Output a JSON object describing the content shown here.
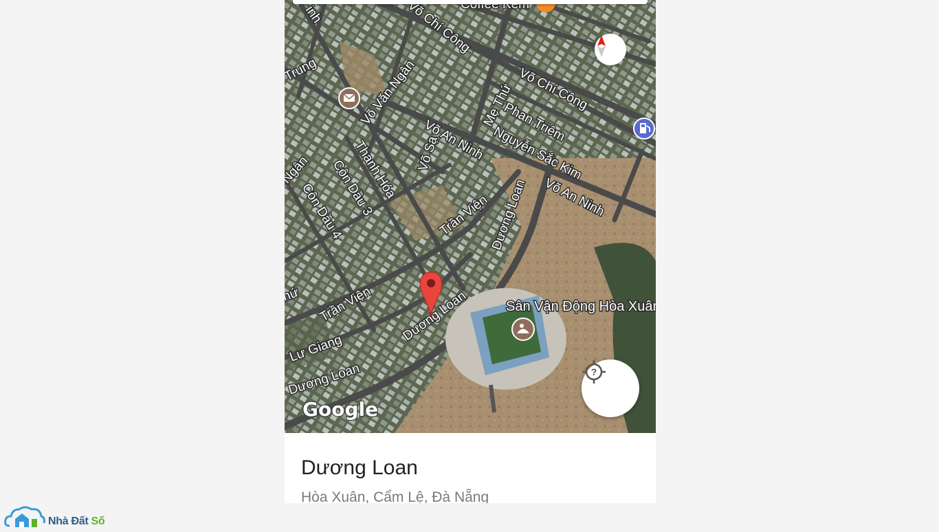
{
  "map": {
    "roads": [
      "Võ Chí Công",
      "Võ Chí Công",
      "Phan Triêm",
      "Mẹ Thứ",
      "Võ An Ninh",
      "Nguyễn Sắc Kim",
      "Võ An Ninh",
      "Võ Văn Ngân",
      "Võ Sạ",
      "Thanh Hóa",
      "Côn Dầu 3",
      "Côn Dầu 4",
      "Trần Viện",
      "Dương Loan",
      "Trần Viện",
      "Dương Loan",
      "Lư Giang",
      "Dương Loan",
      "Trung",
      "Ngân",
      "hứ",
      "inh"
    ],
    "poi_top": "Coffee Kem",
    "stadium_label": "Sân Vận Động Hòa Xuân",
    "provider_logo": "Google",
    "icons": {
      "compass": "compass-icon",
      "locate": "locate-question-icon",
      "pin": "map-pin-icon",
      "post": "mail-icon",
      "fuel": "fuel-icon",
      "stadium": "stadium-icon"
    }
  },
  "place": {
    "name": "Dương Loan",
    "address": "Hòa Xuân, Cẩm Lệ, Đà Nẵng"
  },
  "brand": {
    "part1": "Nhà Đất",
    "part2": "Số",
    "colors": {
      "primary": "#2b5f8a",
      "accent": "#5cb32b"
    }
  }
}
